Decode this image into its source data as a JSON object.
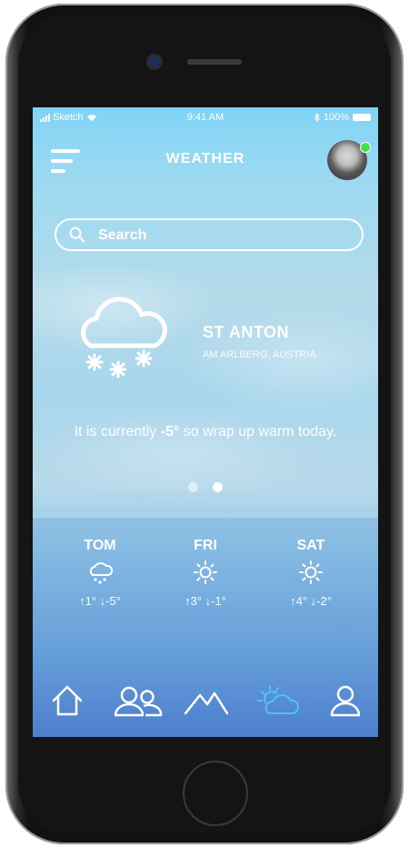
{
  "status_bar": {
    "carrier": "Sketch",
    "time": "9:41 AM",
    "battery": "100%"
  },
  "header": {
    "title": "WEATHER"
  },
  "search": {
    "placeholder": "Search"
  },
  "current": {
    "icon": "snow-cloud-icon",
    "city": "ST ANTON",
    "region": "AM ARLBERG, AUSTRIA",
    "message_prefix": "It is currently ",
    "temperature": "-5°",
    "message_suffix": " so wrap up warm today."
  },
  "pager": {
    "active_index": 1,
    "count": 2
  },
  "forecast": [
    {
      "day": "TOM",
      "icon": "snow-cloud-icon",
      "temps": "↑1° ↓-5°"
    },
    {
      "day": "FRI",
      "icon": "sun-icon",
      "temps": "↑3° ↓-1°"
    },
    {
      "day": "SAT",
      "icon": "sun-icon",
      "temps": "↑4° ↓-2°"
    }
  ],
  "tabbar": {
    "items": [
      {
        "icon": "home-icon"
      },
      {
        "icon": "people-icon"
      },
      {
        "icon": "mountain-icon"
      },
      {
        "icon": "weather-icon",
        "active": true
      },
      {
        "icon": "profile-icon"
      }
    ],
    "active_color": "#4fc3f7",
    "color": "#ffffff"
  }
}
